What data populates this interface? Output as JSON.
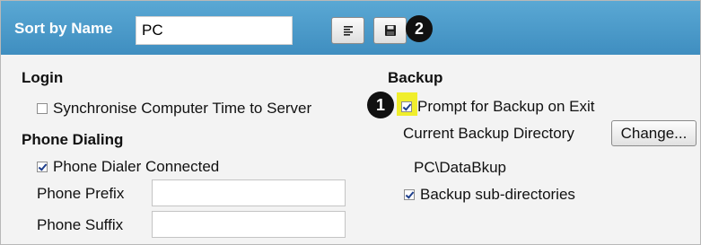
{
  "header": {
    "sort_label": "Sort by Name",
    "sort_value": "PC",
    "list_icon": "list-icon",
    "save_icon": "floppy-disk-icon",
    "badge_2": "2"
  },
  "login": {
    "heading": "Login",
    "sync_time": {
      "label": "Synchronise Computer Time to Server",
      "checked": false
    }
  },
  "phone": {
    "heading": "Phone Dialing",
    "dialer_connected": {
      "label": "Phone Dialer Connected",
      "checked": true
    },
    "prefix_label": "Phone Prefix",
    "prefix_value": "",
    "suffix_label": "Phone Suffix",
    "suffix_value": ""
  },
  "backup": {
    "heading": "Backup",
    "badge_1": "1",
    "prompt_on_exit": {
      "label": "Prompt for Backup on Exit",
      "checked": true
    },
    "directory_label": "Current Backup Directory",
    "change_button": "Change...",
    "directory_value": "PC\\DataBkup",
    "subdirectories": {
      "label": "Backup sub-directories",
      "checked": true
    }
  },
  "colors": {
    "header_bg": "#4a9bcb",
    "highlight": "#f0ee2c",
    "badge": "#111111"
  }
}
